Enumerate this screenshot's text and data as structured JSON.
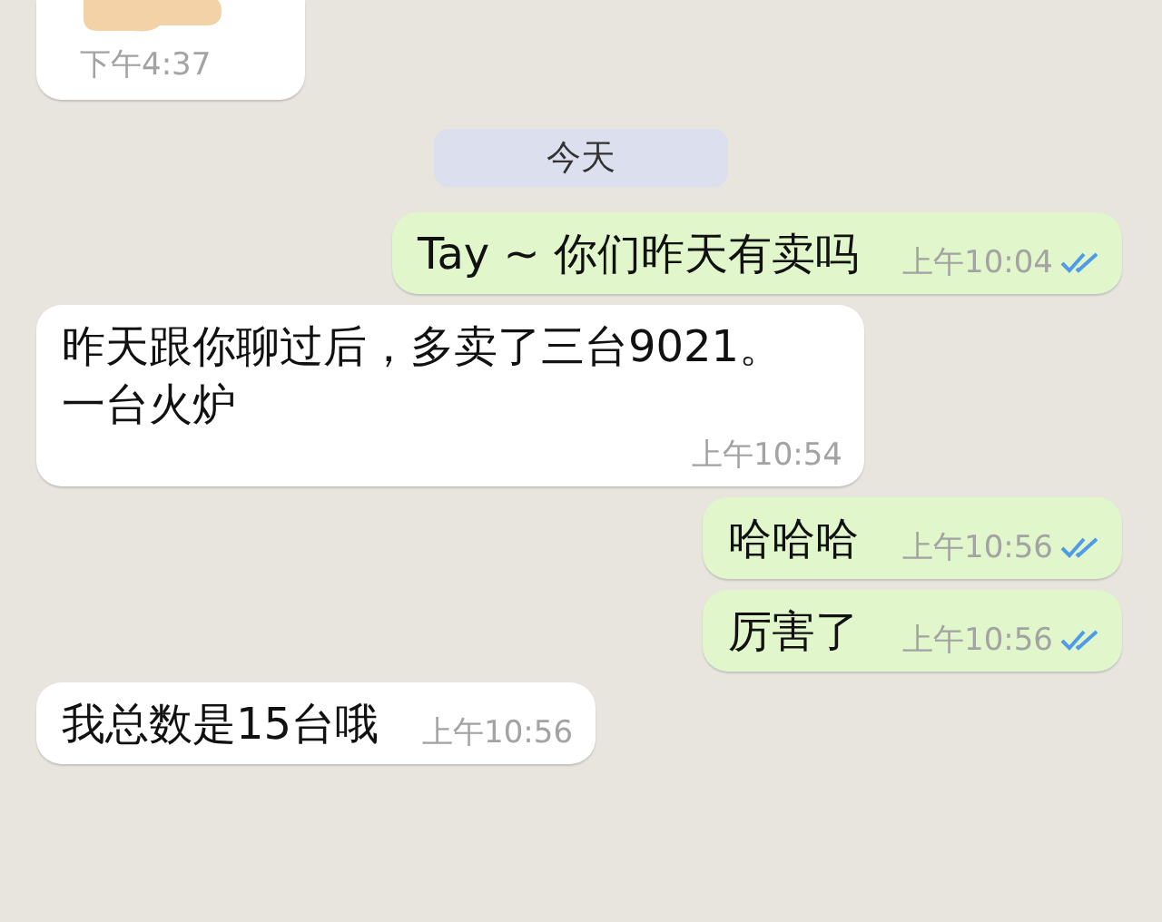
{
  "messages": [
    {
      "kind": "emoji",
      "time": "下午4:37"
    },
    {
      "kind": "date",
      "label": "今天"
    },
    {
      "kind": "outgoing",
      "text": "Tay ~ 你们昨天有卖吗",
      "time": "上午10:04",
      "read": true
    },
    {
      "kind": "incoming",
      "text": "昨天跟你聊过后，多卖了三台9021。一台火炉",
      "time": "上午10:54"
    },
    {
      "kind": "outgoing",
      "text": "哈哈哈",
      "time": "上午10:56",
      "read": true
    },
    {
      "kind": "outgoing",
      "text": "厉害了",
      "time": "上午10:56",
      "read": true
    },
    {
      "kind": "incoming",
      "text": "我总数是15台哦",
      "time": "上午10:56"
    }
  ]
}
